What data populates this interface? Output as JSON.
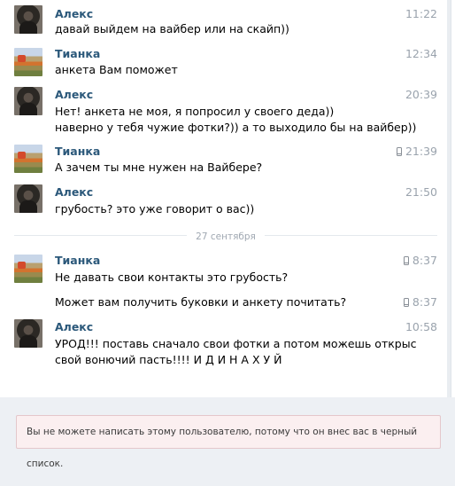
{
  "messages": [
    {
      "author": "Алекс",
      "avatar": "alex",
      "time": "11:22",
      "mobile": false,
      "lines": [
        "давай выйдем на вайбер или на скайп))"
      ]
    },
    {
      "author": "Тианка",
      "avatar": "tianka",
      "time": "12:34",
      "mobile": false,
      "lines": [
        "анкета Вам поможет"
      ]
    },
    {
      "author": "Алекс",
      "avatar": "alex",
      "time": "20:39",
      "mobile": false,
      "lines": [
        "Нет! анкета не моя, я попросил у своего деда))",
        "наверно у тебя чужие фотки?)) а то выходило бы на вайбер))"
      ]
    },
    {
      "author": "Тианка",
      "avatar": "tianka",
      "time": "21:39",
      "mobile": true,
      "lines": [
        "А зачем ты мне нужен на Вайбере?"
      ]
    },
    {
      "author": "Алекс",
      "avatar": "alex",
      "time": "21:50",
      "mobile": false,
      "lines": [
        "грубость? это уже говорит о вас))"
      ]
    },
    {
      "author": "Тианка",
      "avatar": "tianka",
      "time": "8:37",
      "mobile": true,
      "lines": [
        "Не давать свои контакты это грубость?"
      ]
    },
    {
      "author": "",
      "avatar": "",
      "time": "8:37",
      "mobile": true,
      "lines": [
        "Может вам получить буковки и анкету почитать?"
      ]
    },
    {
      "author": "Алекс",
      "avatar": "alex",
      "time": "10:58",
      "mobile": false,
      "lines": [
        "УРОД!!! поставь сначало свои фотки а потом можешь открыс",
        "свой вонючий пасть!!!! И Д И Н А Х У Й"
      ]
    }
  ],
  "date_divider": "27 сентября",
  "blocked_notice": "Вы не можете написать этому пользователю, потому что он внес вас в черный список.",
  "colors": {
    "name": "#2b587a",
    "time": "#9aa3ad",
    "notice_bg": "#fbeff0",
    "notice_border": "#e4c7cb"
  }
}
